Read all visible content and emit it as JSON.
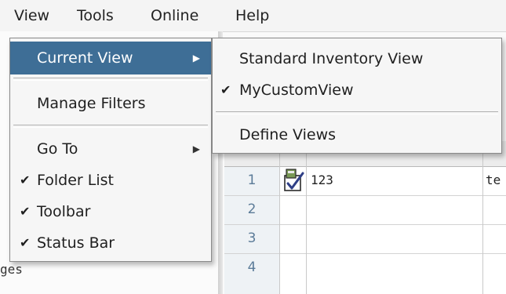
{
  "menubar": {
    "items": [
      {
        "label": "View"
      },
      {
        "label": "Tools"
      },
      {
        "label": "Online"
      },
      {
        "label": "Help"
      }
    ]
  },
  "view_menu": {
    "current_view": {
      "label": "Current View",
      "has_submenu": true,
      "highlighted": true
    },
    "manage_filters": {
      "label": "Manage Filters"
    },
    "go_to": {
      "label": "Go To",
      "has_submenu": true
    },
    "folder_list": {
      "label": "Folder List",
      "checked": true
    },
    "toolbar": {
      "label": "Toolbar",
      "checked": true
    },
    "status_bar": {
      "label": "Status Bar",
      "checked": true
    },
    "check_glyph": "✔",
    "arrow_glyph": "▶"
  },
  "current_view_submenu": {
    "standard": {
      "label": "Standard Inventory View",
      "checked": false
    },
    "custom": {
      "label": "MyCustomView",
      "checked": true
    },
    "define": {
      "label": "Define Views"
    }
  },
  "left_panel": {
    "partial_text": "ges"
  },
  "grid": {
    "rows": [
      {
        "num": "1",
        "checked": true,
        "col1": "123",
        "col2": "te"
      },
      {
        "num": "2",
        "col1": "",
        "col2": ""
      },
      {
        "num": "3",
        "col1": "",
        "col2": ""
      },
      {
        "num": "4",
        "col1": "",
        "col2": ""
      }
    ]
  },
  "colors": {
    "highlight": "#3e6e96",
    "row_number": "#5b7b98",
    "menu_bg": "#f6f6f6"
  }
}
